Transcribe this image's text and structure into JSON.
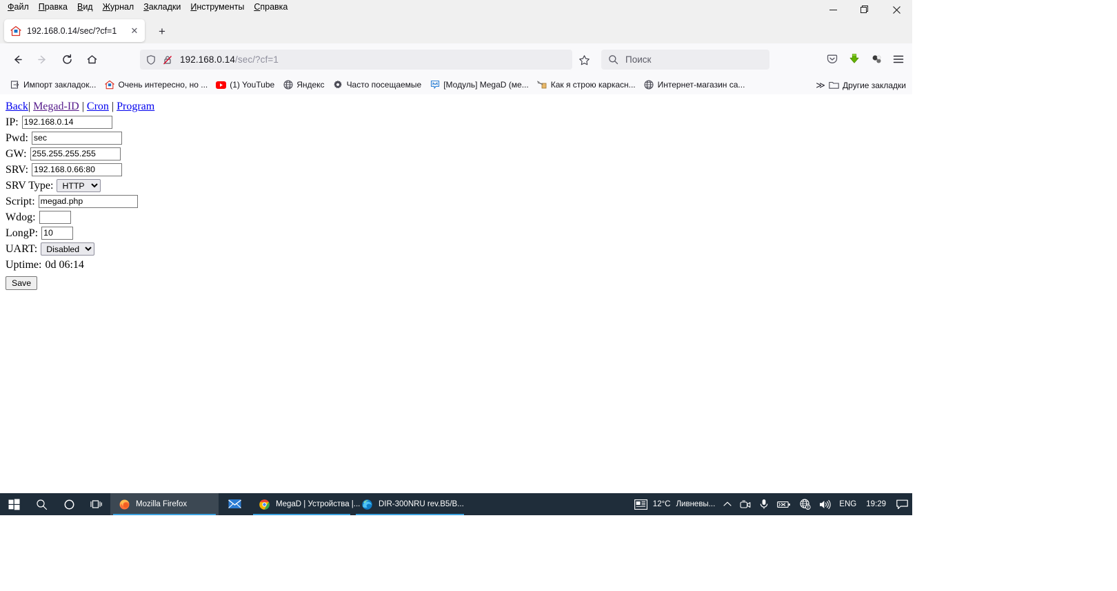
{
  "window": {
    "controls": {
      "minimize": "—",
      "maximize": "❐",
      "close": "✕"
    },
    "menubar": [
      {
        "name": "file",
        "prefix": "",
        "key": "Ф",
        "rest": "айл"
      },
      {
        "name": "edit",
        "prefix": "",
        "key": "П",
        "rest": "равка"
      },
      {
        "name": "view",
        "prefix": "",
        "key": "В",
        "rest": "ид"
      },
      {
        "name": "history",
        "prefix": "",
        "key": "Ж",
        "rest": "урнал"
      },
      {
        "name": "bookmarks",
        "prefix": "",
        "key": "З",
        "rest": "акладки"
      },
      {
        "name": "tools",
        "prefix": "",
        "key": "И",
        "rest": "нструменты"
      },
      {
        "name": "help",
        "prefix": "",
        "key": "С",
        "rest": "правка"
      }
    ]
  },
  "tabs": {
    "active": {
      "title": "192.168.0.14/sec/?cf=1",
      "favicon": "house-icon",
      "close": "✕"
    },
    "newtab_label": "+"
  },
  "toolbar": {
    "back": "←",
    "forward": "→",
    "reload": "⟳",
    "home": "home-icon",
    "url_host": "192.168.0.14",
    "url_path": "/sec/?cf=1",
    "shield_icon": "shield-icon",
    "lock_icon": "lock-crossed-icon",
    "star_icon": "star-icon",
    "search_placeholder": "Поиск",
    "search_icon": "search-icon",
    "pocket_icon": "pocket-icon",
    "downloads_icon": "download-arrow-icon",
    "extension_icon": "extension-icon",
    "menu_icon": "hamburger-menu-icon"
  },
  "bookmarks": {
    "items": [
      {
        "label": "Импорт закладок...",
        "icon": "import-icon"
      },
      {
        "label": "Очень интересно, но ...",
        "icon": "house-icon"
      },
      {
        "label": "(1) YouTube",
        "icon": "youtube-icon"
      },
      {
        "label": "Яндекс",
        "icon": "globe-icon"
      },
      {
        "label": "Часто посещаемые",
        "icon": "gear-icon"
      },
      {
        "label": "[Модуль] MegaD (ме...",
        "icon": "megad-m-icon"
      },
      {
        "label": "Как я строю каркасн...",
        "icon": "build-icon"
      },
      {
        "label": "Интернет-магазин са...",
        "icon": "globe-icon"
      }
    ],
    "overflow": "≫",
    "other_label": "Другие закладки",
    "other_icon": "folder-icon"
  },
  "page": {
    "nav": {
      "back": "Back",
      "megad_id": "Megad-ID",
      "cron": "Cron",
      "program": "Program",
      "separator": "|"
    },
    "fields": {
      "ip_label": "IP:",
      "ip_value": "192.168.0.14",
      "pwd_label": "Pwd:",
      "pwd_value": "sec",
      "gw_label": "GW:",
      "gw_value": "255.255.255.255",
      "srv_label": "SRV:",
      "srv_value": "192.168.0.66:80",
      "srv_type_label": "SRV Type:",
      "srv_type_value": "HTTP",
      "script_label": "Script:",
      "script_value": "megad.php",
      "wdog_label": "Wdog:",
      "wdog_value": "",
      "longp_label": "LongP:",
      "longp_value": "10",
      "uart_label": "UART:",
      "uart_value": "Disabled",
      "uptime_label": "Uptime:",
      "uptime_value": "0d 06:14"
    },
    "save_button": "Save"
  },
  "taskbar": {
    "start_icon": "windows-start-icon",
    "search_icon": "search-icon",
    "cortana_icon": "cortana-circle-icon",
    "taskview_icon": "task-view-icon",
    "apps": [
      {
        "label": "Mozilla Firefox",
        "icon": "firefox-icon",
        "state": "active"
      },
      {
        "label": "",
        "icon": "mail-icon",
        "state": "pinned"
      },
      {
        "label": "MegaD | Устройства |...",
        "icon": "chrome-icon",
        "state": "open"
      },
      {
        "label": "DIR-300NRU rev.B5/B...",
        "icon": "edge-icon",
        "state": "open"
      }
    ],
    "tray": {
      "news_icon": "news-icon",
      "weather_temp": "12°C",
      "weather_text": "Ливневы...",
      "chevron": "∧",
      "camera_icon": "camera-icon",
      "mic_icon": "microphone-icon",
      "battery_icon": "battery-x-icon",
      "network_icon": "network-warning-icon",
      "volume_icon": "speaker-icon",
      "language": "ENG",
      "clock": "19:29",
      "action_center_icon": "action-center-icon"
    }
  }
}
